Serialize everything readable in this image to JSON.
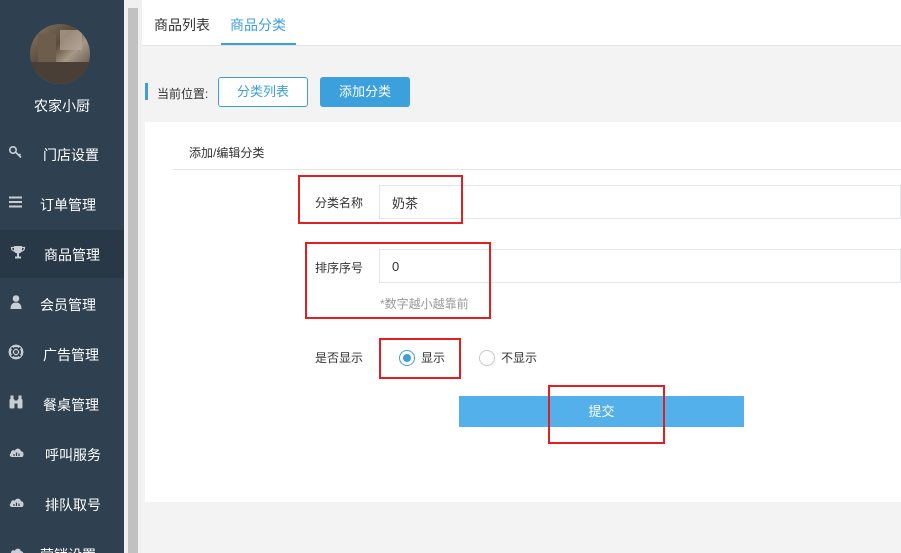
{
  "sidebar": {
    "store_name": "农家小厨",
    "items": [
      {
        "label": "门店设置",
        "icon": "key-icon"
      },
      {
        "label": "订单管理",
        "icon": "list-icon"
      },
      {
        "label": "商品管理",
        "icon": "trophy-icon",
        "active": true
      },
      {
        "label": "会员管理",
        "icon": "user-icon"
      },
      {
        "label": "广告管理",
        "icon": "life-ring-icon"
      },
      {
        "label": "餐桌管理",
        "icon": "binoculars-icon"
      },
      {
        "label": "呼叫服务",
        "icon": "cloud-icon"
      },
      {
        "label": "排队取号",
        "icon": "cloud-icon"
      },
      {
        "label": "营销设置",
        "icon": "cloud-icon"
      }
    ]
  },
  "tabs": [
    {
      "label": "商品列表"
    },
    {
      "label": "商品分类",
      "active": true
    }
  ],
  "breadcrumb": {
    "label": "当前位置:",
    "btn_list": "分类列表",
    "btn_add": "添加分类"
  },
  "form": {
    "title": "添加/编辑分类",
    "name_label": "分类名称",
    "name_value": "奶茶",
    "sort_label": "排序序号",
    "sort_value": "0",
    "sort_hint": "*数字越小越靠前",
    "show_label": "是否显示",
    "show_option": "显示",
    "hide_option": "不显示",
    "selected": "显示",
    "submit_label": "提交"
  },
  "colors": {
    "sidebar_bg": "#2f4050",
    "accent": "#3ca0dc",
    "submit_bg": "#54b0ea",
    "annotation": "#e02020"
  }
}
